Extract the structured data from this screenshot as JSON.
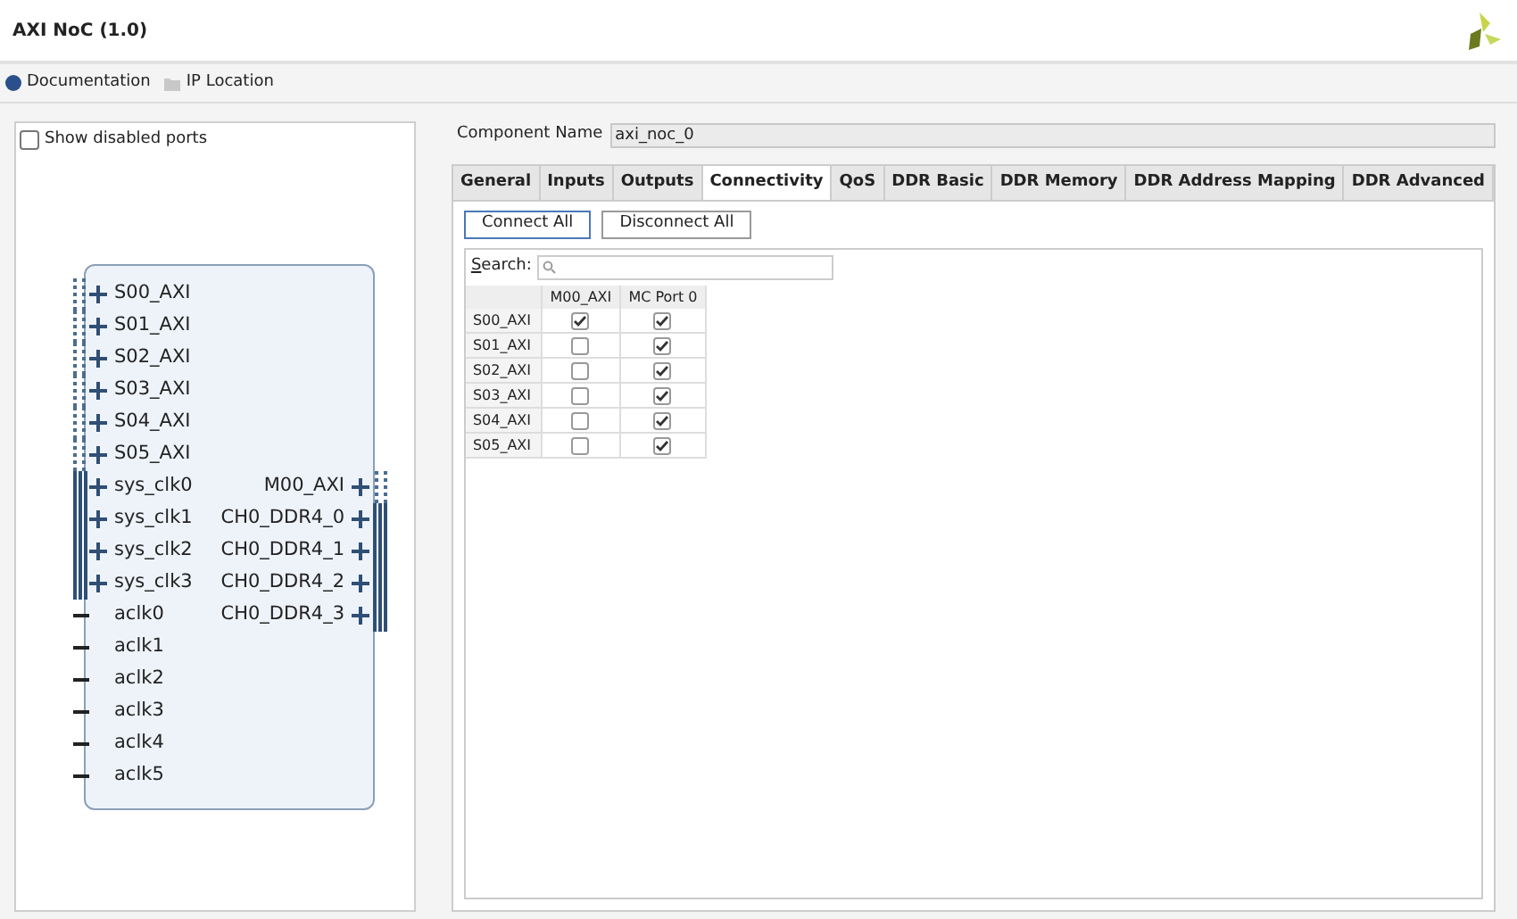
{
  "window": {
    "title": "AXI NoC (1.0)"
  },
  "toolbar": [
    "Documentation",
    "IP Location"
  ],
  "symbol_panel": {
    "show_disabled_ports": {
      "label": "Show disabled ports",
      "checked": false
    },
    "left_pins": [
      {
        "name": "S00_AXI",
        "kind": "interface"
      },
      {
        "name": "S01_AXI",
        "kind": "interface"
      },
      {
        "name": "S02_AXI",
        "kind": "interface"
      },
      {
        "name": "S03_AXI",
        "kind": "interface"
      },
      {
        "name": "S04_AXI",
        "kind": "interface"
      },
      {
        "name": "S05_AXI",
        "kind": "interface"
      },
      {
        "name": "sys_clk0",
        "kind": "bus"
      },
      {
        "name": "sys_clk1",
        "kind": "bus"
      },
      {
        "name": "sys_clk2",
        "kind": "bus"
      },
      {
        "name": "sys_clk3",
        "kind": "bus"
      },
      {
        "name": "aclk0",
        "kind": "wire"
      },
      {
        "name": "aclk1",
        "kind": "wire"
      },
      {
        "name": "aclk2",
        "kind": "wire"
      },
      {
        "name": "aclk3",
        "kind": "wire"
      },
      {
        "name": "aclk4",
        "kind": "wire"
      },
      {
        "name": "aclk5",
        "kind": "wire"
      }
    ],
    "right_pins": [
      {
        "name": "M00_AXI",
        "kind": "interface"
      },
      {
        "name": "CH0_DDR4_0",
        "kind": "bus"
      },
      {
        "name": "CH0_DDR4_1",
        "kind": "bus"
      },
      {
        "name": "CH0_DDR4_2",
        "kind": "bus"
      },
      {
        "name": "CH0_DDR4_3",
        "kind": "bus"
      }
    ]
  },
  "component_name": {
    "label": "Component Name",
    "value": "axi_noc_0"
  },
  "tabs": [
    {
      "label": "General",
      "selected": false
    },
    {
      "label": "Inputs",
      "selected": false
    },
    {
      "label": "Outputs",
      "selected": false
    },
    {
      "label": "Connectivity",
      "selected": true
    },
    {
      "label": "QoS",
      "selected": false
    },
    {
      "label": "DDR Basic",
      "selected": false
    },
    {
      "label": "DDR Memory",
      "selected": false
    },
    {
      "label": "DDR Address Mapping",
      "selected": false
    },
    {
      "label": "DDR Advanced",
      "selected": false
    }
  ],
  "buttons": [
    "Connect All",
    "Disconnect All"
  ],
  "search": {
    "label": "Search:"
  },
  "table": {
    "columns": [
      "M00_AXI",
      "MC Port 0"
    ],
    "rows": [
      {
        "name": "S00_AXI",
        "cells": [
          {
            "checked": true
          },
          {
            "checked": true
          }
        ]
      },
      {
        "name": "S01_AXI",
        "cells": [
          {
            "checked": false
          },
          {
            "checked": true
          }
        ]
      },
      {
        "name": "S02_AXI",
        "cells": [
          {
            "checked": false
          },
          {
            "checked": true
          }
        ]
      },
      {
        "name": "S03_AXI",
        "cells": [
          {
            "checked": false
          },
          {
            "checked": true
          }
        ]
      },
      {
        "name": "S04_AXI",
        "cells": [
          {
            "checked": false
          },
          {
            "checked": true
          }
        ]
      },
      {
        "name": "S05_AXI",
        "cells": [
          {
            "checked": false
          },
          {
            "checked": true
          }
        ]
      }
    ]
  }
}
